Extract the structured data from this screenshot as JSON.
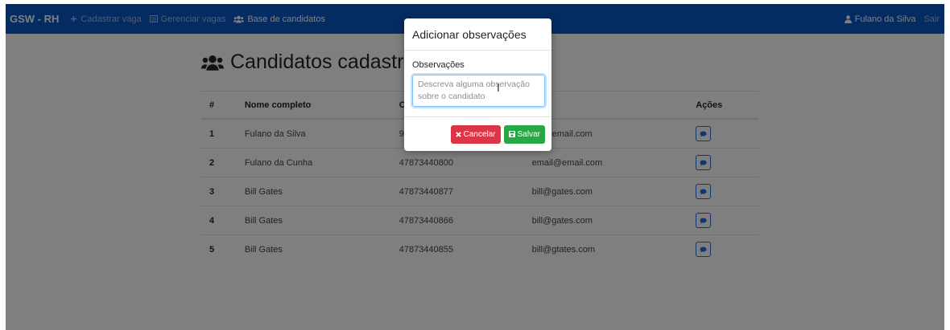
{
  "navbar": {
    "brand": "GSW - RH",
    "links": [
      {
        "label": "Cadastrar vaga",
        "icon": "plus-icon"
      },
      {
        "label": "Gerenciar vagas",
        "icon": "list-icon"
      },
      {
        "label": "Base de candidatos",
        "icon": "users-icon"
      }
    ],
    "user": {
      "label": "Fulano da Silva",
      "icon": "user-icon"
    },
    "logout": "Sair"
  },
  "page": {
    "title": "Candidatos cadastr",
    "title_icon": "users-icon"
  },
  "table": {
    "headers": [
      "#",
      "Nome completo",
      "C",
      "",
      "Ações"
    ],
    "rows": [
      {
        "idx": "1",
        "name": "Fulano da Silva",
        "phone": "9",
        "email": "email.com"
      },
      {
        "idx": "2",
        "name": "Fulano da Cunha",
        "phone": "47873440800",
        "email": "email@email.com"
      },
      {
        "idx": "3",
        "name": "Bill Gates",
        "phone": "47873440877",
        "email": "bill@gates.com"
      },
      {
        "idx": "4",
        "name": "Bill Gates",
        "phone": "47873440866",
        "email": "bill@gates.com"
      },
      {
        "idx": "5",
        "name": "Bill Gates",
        "phone": "47873440855",
        "email": "bill@gtates.com"
      }
    ],
    "action_icon": "comment-icon"
  },
  "modal": {
    "title": "Adicionar observações",
    "field_label": "Observações",
    "placeholder": "Descreva alguma observação sobre o candidato",
    "cancel_label": "Cancelar",
    "save_label": "Salvar"
  },
  "colors": {
    "navbar": "#0a59c4",
    "cancel": "#dc3545",
    "save": "#28a745",
    "action_border": "#1f6fd8"
  }
}
